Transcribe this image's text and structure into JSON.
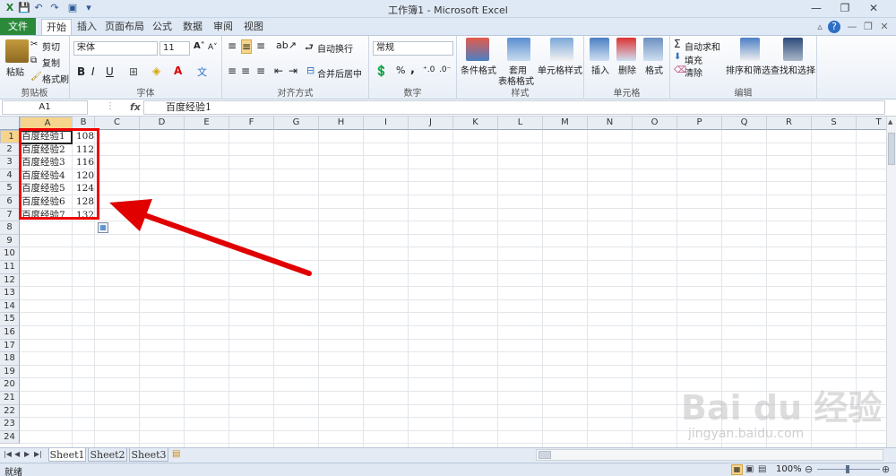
{
  "window": {
    "title": "工作簿1 - Microsoft Excel",
    "min": "—",
    "restore": "❐",
    "close": "✕"
  },
  "tabs": {
    "file": "文件",
    "items": [
      "开始",
      "插入",
      "页面布局",
      "公式",
      "数据",
      "审阅",
      "视图"
    ]
  },
  "clipboard": {
    "paste": "粘贴",
    "cut": "剪切",
    "copy": "复制",
    "painter": "格式刷",
    "label": "剪贴板"
  },
  "font": {
    "name": "宋体",
    "size": "11",
    "bold": "B",
    "italic": "I",
    "underline": "U",
    "label": "字体"
  },
  "align": {
    "wrap": "自动换行",
    "merge": "合并后居中",
    "label": "对齐方式"
  },
  "number": {
    "format": "常规",
    "percent": "%",
    "comma": ",",
    "label": "数字"
  },
  "styles": {
    "cond": "条件格式",
    "table1": "套用",
    "table2": "表格格式",
    "cell_style": "单元格样式",
    "label": "样式"
  },
  "cells": {
    "insert": "插入",
    "delete": "删除",
    "format": "格式",
    "label": "单元格"
  },
  "edit": {
    "autosum": "自动求和",
    "fill": "填充",
    "clear": "清除",
    "sort": "排序和筛选",
    "find": "查找和选择",
    "label": "编辑"
  },
  "formula_bar": {
    "name_box": "A1",
    "fx": "fx",
    "content": "百度经验1"
  },
  "columns": [
    "A",
    "B",
    "C",
    "D",
    "E",
    "F",
    "G",
    "H",
    "I",
    "J",
    "K",
    "L",
    "M",
    "N",
    "O",
    "P",
    "Q",
    "R",
    "S",
    "T"
  ],
  "rows": [
    "1",
    "2",
    "3",
    "4",
    "5",
    "6",
    "7",
    "8",
    "9",
    "10",
    "11",
    "12",
    "13",
    "14",
    "15",
    "16",
    "17",
    "18",
    "19",
    "20",
    "21",
    "22",
    "23",
    "24"
  ],
  "cells_data": [
    {
      "a": "百度经验1",
      "b": "108"
    },
    {
      "a": "百度经验2",
      "b": "112"
    },
    {
      "a": "百度经验3",
      "b": "116"
    },
    {
      "a": "百度经验4",
      "b": "120"
    },
    {
      "a": "百度经验5",
      "b": "124"
    },
    {
      "a": "百度经验6",
      "b": "128"
    },
    {
      "a": "百度经验7",
      "b": "132"
    }
  ],
  "sheets": [
    "Sheet1",
    "Sheet2",
    "Sheet3"
  ],
  "status": {
    "ready": "就绪",
    "zoom": "100%"
  },
  "watermark": {
    "brand": "Bai du 经验",
    "url": "jingyan.baidu.com"
  },
  "colors": {
    "accent": "#2a8a3a",
    "annotation": "#e00000",
    "selection": "#f7d48b"
  }
}
